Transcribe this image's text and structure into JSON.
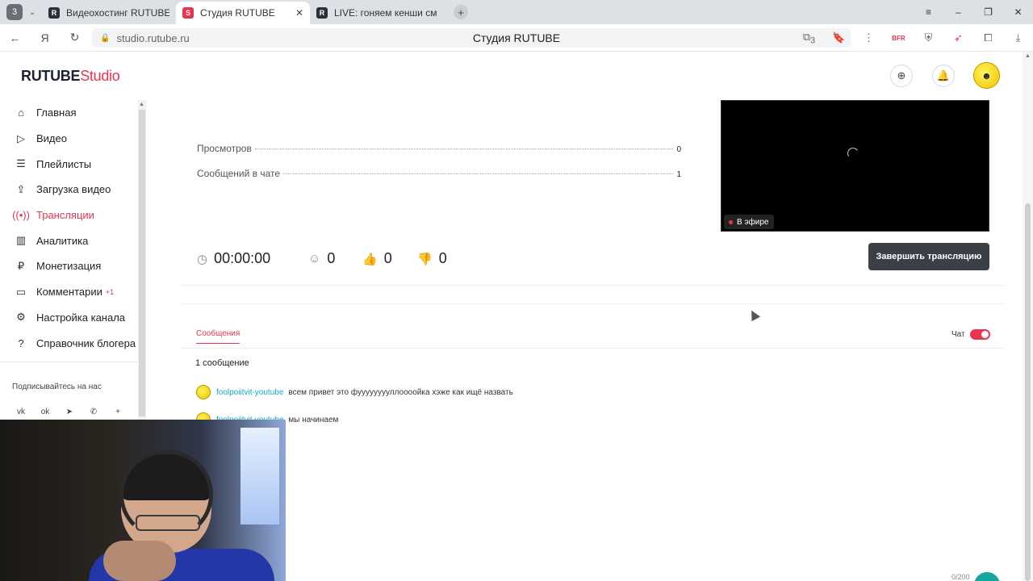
{
  "browser": {
    "tab_count": "3",
    "tabs": [
      {
        "title": "Видеохостинг RUTUBE. С",
        "active": false
      },
      {
        "title": "Студия RUTUBE",
        "active": true
      },
      {
        "title": "LIVE: гоняем кенши смот",
        "active": false
      }
    ],
    "url": "studio.rutube.ru",
    "page_title": "Студия RUTUBE",
    "extension_badge": "3",
    "ext_label": "BFR"
  },
  "header": {
    "logo_main": "RUTUBE",
    "logo_studio": "Studio"
  },
  "sidebar": {
    "items": [
      {
        "label": "Главная",
        "icon": "home-icon",
        "active": false
      },
      {
        "label": "Видео",
        "icon": "video-icon",
        "active": false
      },
      {
        "label": "Плейлисты",
        "icon": "playlist-icon",
        "active": false
      },
      {
        "label": "Загрузка видео",
        "icon": "upload-icon",
        "active": false
      },
      {
        "label": "Трансляции",
        "icon": "broadcast-icon",
        "active": true
      },
      {
        "label": "Аналитика",
        "icon": "analytics-icon",
        "active": false
      },
      {
        "label": "Монетизация",
        "icon": "money-icon",
        "active": false
      },
      {
        "label": "Комментарии",
        "icon": "comments-icon",
        "active": false,
        "badge": "+1"
      },
      {
        "label": "Настройка канала",
        "icon": "settings-icon",
        "active": false
      },
      {
        "label": "Справочник блогера",
        "icon": "help-icon",
        "active": false
      }
    ],
    "subscribe_label": "Подписывайтесь на нас"
  },
  "stream": {
    "stats": [
      {
        "label": "Просмотров",
        "value": "0"
      },
      {
        "label": "Сообщений в чате",
        "value": "1"
      }
    ],
    "duration": "00:00:00",
    "viewers": "0",
    "likes": "0",
    "dislikes": "0",
    "live_badge": "В эфире",
    "end_button": "Завершить трансляцию"
  },
  "chat": {
    "tab_label": "Сообщения",
    "toggle_label": "Чат",
    "toggle_on": true,
    "message_count": "1 сообщение",
    "messages": [
      {
        "author": "foolpoiitvit-youtube",
        "text": "всем привет это фууууууууллоооойка хэже как ищё назвать"
      },
      {
        "author": "foolpoiitvit-youtube",
        "text": "мы начинаем"
      }
    ],
    "char_counter": "0/200"
  },
  "colors": {
    "accent": "#e8344e",
    "link": "#13a8c9",
    "dark_button": "#3b3f46"
  }
}
